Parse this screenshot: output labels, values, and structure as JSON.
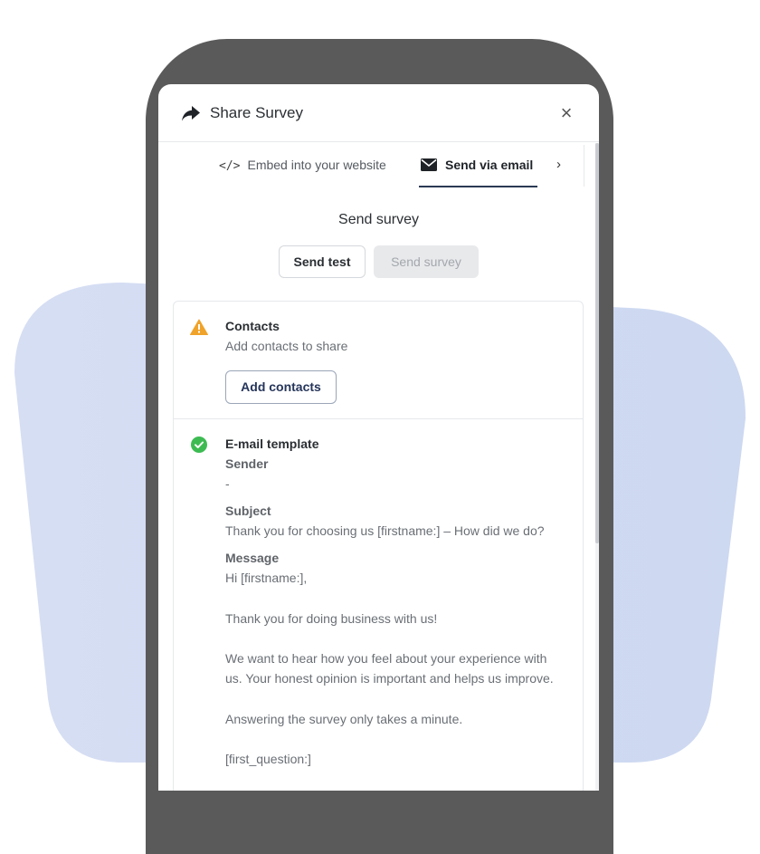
{
  "header": {
    "title": "Share Survey",
    "close_glyph": "×"
  },
  "tabs": [
    {
      "label": "Embed into your website",
      "icon": "code-icon"
    },
    {
      "label": "Send via email",
      "icon": "envelope-icon",
      "active": true
    }
  ],
  "tab_arrow": "›",
  "send": {
    "heading": "Send survey",
    "test_label": "Send test",
    "survey_label": "Send survey"
  },
  "contacts": {
    "title": "Contacts",
    "subtitle": "Add contacts to share",
    "add_label": "Add contacts"
  },
  "template": {
    "title": "E-mail template",
    "sender_label": "Sender",
    "sender_value": "-",
    "subject_label": "Subject",
    "subject_value": "Thank you for choosing us [firstname:] – How did we do?",
    "message_label": "Message",
    "message_lines": [
      "Hi [firstname:],",
      "Thank you for doing business with us!",
      "We want to hear how you feel about your experience with",
      "us. Your honest opinion is important and helps us improve.",
      "Answering the survey only takes a minute.",
      "[first_question:]"
    ]
  },
  "colors": {
    "accent": "#2b3a55",
    "warning": "#f0a32a",
    "success": "#3dbb52",
    "blob": "#d2dcf2"
  }
}
